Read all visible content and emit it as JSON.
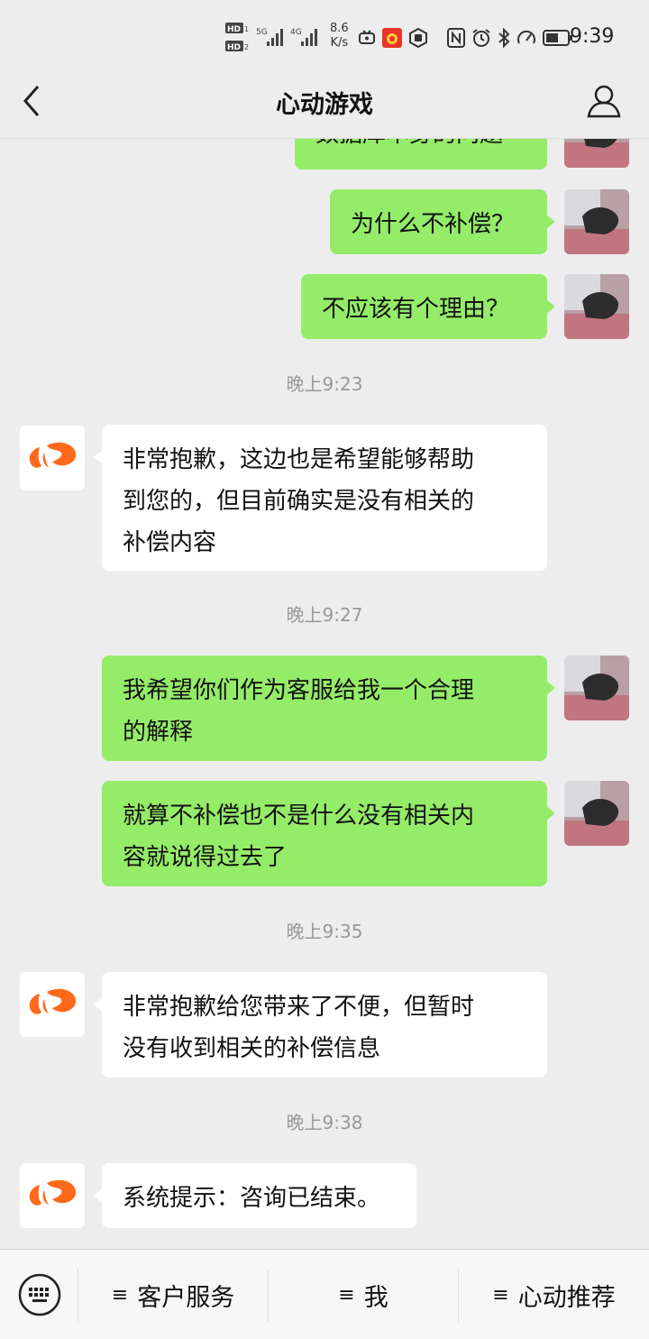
{
  "status_bar": {
    "net_speed_value": "8.6",
    "net_speed_unit": "K/s",
    "net_labels": [
      "HD",
      "HD",
      "5G",
      "4G"
    ],
    "time": "9:39",
    "icons": [
      "video-icon",
      "app-notification-icon",
      "hand-icon",
      "nfc-icon",
      "alarm-icon",
      "bluetooth-icon",
      "speedometer-icon",
      "battery-icon"
    ]
  },
  "header": {
    "title": "心动游戏",
    "back_icon": "chevron-left-icon",
    "profile_icon": "user-icon"
  },
  "messages": [
    {
      "side": "mine",
      "text": "数据库本身的问题",
      "partial": true
    },
    {
      "side": "mine",
      "text": "为什么不补偿？"
    },
    {
      "side": "mine",
      "text": "不应该有个理由？"
    },
    {
      "timestamp": "晚上9:23"
    },
    {
      "side": "theirs",
      "lines": [
        "非常抱歉，这边也是希望能够帮助",
        "到您的，但目前确实是没有相关的",
        "补偿内容"
      ]
    },
    {
      "timestamp": "晚上9:27"
    },
    {
      "side": "mine",
      "lines": [
        "我希望你们作为客服给我一个合理",
        "的解释"
      ]
    },
    {
      "side": "mine",
      "lines": [
        "就算不补偿也不是什么没有相关内",
        "容就说得过去了"
      ]
    },
    {
      "timestamp": "晚上9:35"
    },
    {
      "side": "theirs",
      "lines": [
        "非常抱歉给您带来了不便，但暂时",
        "没有收到相关的补偿信息"
      ]
    },
    {
      "timestamp": "晚上9:38"
    },
    {
      "side": "theirs",
      "text": "系统提示：咨询已结束。"
    }
  ],
  "bottom_menu": {
    "keyboard_icon": "keyboard-icon",
    "menu_icon": "≡",
    "items": [
      "客户服务",
      "我",
      "心动推荐"
    ]
  },
  "colors": {
    "background": "#ededed",
    "my_bubble": "#95ec69",
    "their_bubble": "#ffffff",
    "brand_orange": "#ff6a1a"
  }
}
